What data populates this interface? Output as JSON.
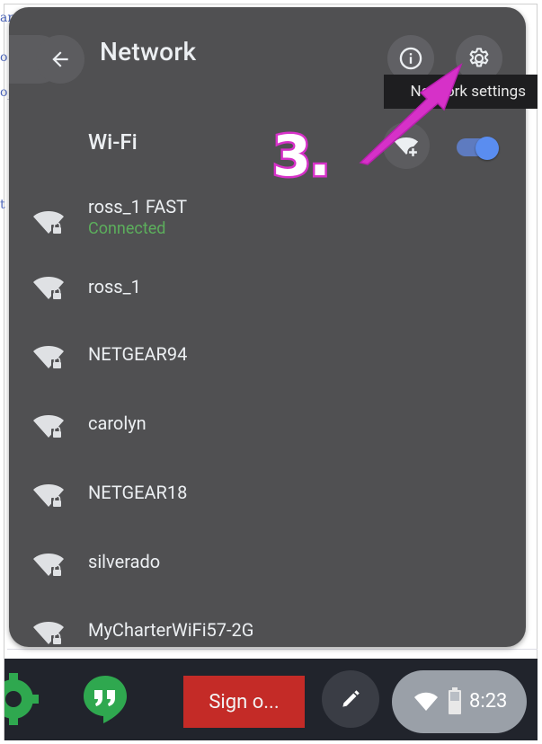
{
  "header": {
    "title": "Network",
    "tooltip": "Network settings"
  },
  "wifi": {
    "label": "Wi-Fi",
    "enabled": true
  },
  "networks": [
    {
      "name": "ross_1 FAST",
      "status": "Connected"
    },
    {
      "name": "ross_1",
      "status": ""
    },
    {
      "name": "NETGEAR94",
      "status": ""
    },
    {
      "name": "carolyn",
      "status": ""
    },
    {
      "name": "NETGEAR18",
      "status": ""
    },
    {
      "name": "silverado",
      "status": ""
    },
    {
      "name": "MyCharterWiFi57-2G",
      "status": ""
    }
  ],
  "annotation": {
    "step": "3."
  },
  "shelf": {
    "signout_label": "Sign o...",
    "time": "8:23"
  },
  "background_text": [
    "ar",
    "o",
    "o",
    "t"
  ],
  "colors": {
    "panel": "#505052",
    "connected": "#5cae5c",
    "toggle": "#5a8df0",
    "annotation": "#d631c8",
    "signout": "#c42b27"
  }
}
